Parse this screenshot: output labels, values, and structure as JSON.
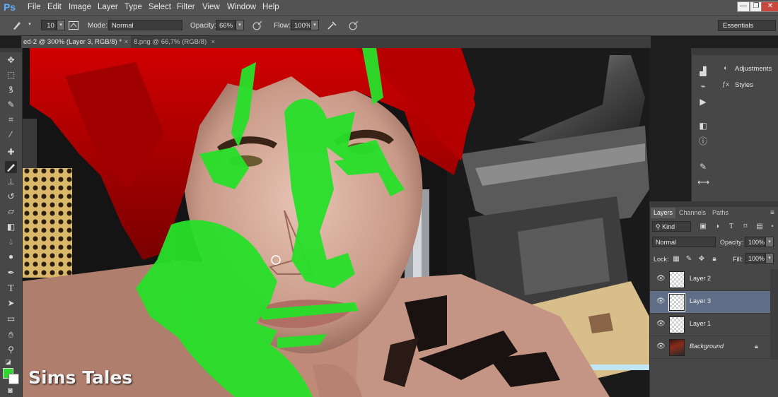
{
  "app": {
    "logo": "Ps"
  },
  "menu": [
    "File",
    "Edit",
    "Image",
    "Layer",
    "Type",
    "Select",
    "Filter",
    "View",
    "Window",
    "Help"
  ],
  "window_controls": {
    "minimize": "—",
    "restore": "❐",
    "close": "✕"
  },
  "options_bar": {
    "brush_size": "10",
    "mode_label": "Mode:",
    "mode_value": "Normal",
    "opacity_label": "Opacity:",
    "opacity_value": "66%",
    "flow_label": "Flow:",
    "flow_value": "100%",
    "workspace": "Essentials"
  },
  "tabs": [
    {
      "label": "ed-2 @ 300% (Layer 3, RGB/8) *",
      "close": "×",
      "active": true
    },
    {
      "label": "8.png @ 66,7% (RGB/8)",
      "close": "×",
      "active": false
    }
  ],
  "tools": [
    "move-tool",
    "marquee-tool",
    "lasso-tool",
    "quick-selection-tool",
    "crop-tool",
    "eyedropper-tool",
    "healing-brush-tool",
    "brush-tool",
    "clone-stamp-tool",
    "history-brush-tool",
    "eraser-tool",
    "gradient-tool",
    "blur-tool",
    "dodge-tool",
    "pen-tool",
    "type-tool",
    "path-selection-tool",
    "rectangle-tool",
    "hand-tool",
    "zoom-tool"
  ],
  "colors": {
    "foreground": "#2fd62f",
    "background": "#ffffff",
    "accent": "#5f6e86"
  },
  "side_panels": [
    {
      "label": "Adjustments",
      "icon": "adjustments-icon"
    },
    {
      "label": "Styles",
      "icon": "styles-icon"
    }
  ],
  "layers_panel": {
    "tabs": [
      "Layers",
      "Channels",
      "Paths"
    ],
    "filter_kind": "Kind",
    "blend_mode": "Normal",
    "opacity_label": "Opacity:",
    "opacity_value": "100%",
    "lock_label": "Lock:",
    "fill_label": "Fill:",
    "fill_value": "100%",
    "layers": [
      {
        "name": "Layer 2",
        "selected": false
      },
      {
        "name": "Layer 3",
        "selected": true
      },
      {
        "name": "Layer 1",
        "selected": false
      },
      {
        "name": "Background",
        "selected": false,
        "locked": true
      }
    ]
  },
  "watermark": "Sims Tales"
}
